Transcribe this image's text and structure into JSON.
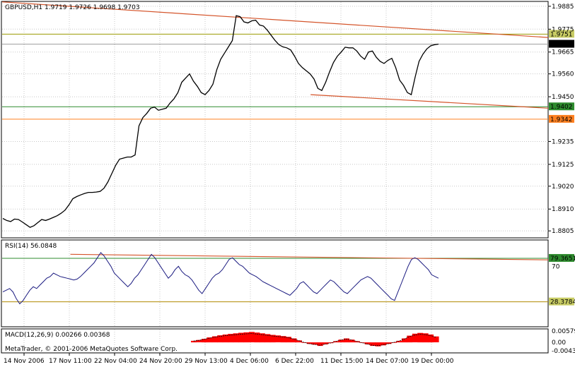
{
  "colors": {
    "background": "#ffffff",
    "frame": "#000000",
    "grid": "#c8c8c8",
    "price_line": "#000000",
    "trend_line": "#d4542a",
    "level_olive": "#9a9a00",
    "level_green": "#2e8b2e",
    "level_orange": "#ff8020",
    "rsi_line": "#1a1a80",
    "rsi_level_green": "#2e8b2e",
    "rsi_level_olive": "#b08a00",
    "macd_hist": "#ff0000",
    "macd_signal": "#000000",
    "tag_bg_light": "#c8cc64"
  },
  "chart_data": [
    {
      "type": "line",
      "panel": "price",
      "title": "GBPUSD,H1 1.9719 1.9726 1.9698 1.9703",
      "symbol": "GBPUSD,H1",
      "ohlc": [
        "1.9719",
        "1.9726",
        "1.9698",
        "1.9703"
      ],
      "ylim": [
        1.8775,
        1.9905
      ],
      "yticks": [
        "1.9885",
        "1.9775",
        "1.9665",
        "1.9560",
        "1.9450",
        "1.9235",
        "1.9125",
        "1.9020",
        "1.8910",
        "1.8805"
      ],
      "xlabels": [
        "14 Nov 2006",
        "17 Nov 11:00",
        "22 Nov 04:00",
        "24 Nov 20:00",
        "29 Nov 13:00",
        "4 Dec 06:00",
        "6 Dec 22:00",
        "11 Dec 15:00",
        "14 Dec 07:00",
        "19 Dec 00:00"
      ],
      "levels": [
        {
          "value": 1.9751,
          "label": "1.9751",
          "style": "olive"
        },
        {
          "value": 1.9402,
          "label": "1.9402",
          "style": "green"
        },
        {
          "value": 1.9342,
          "label": "1.9342",
          "style": "orange"
        }
      ],
      "current": {
        "value": 1.9703,
        "label": "1.9703"
      },
      "trendlines": [
        {
          "from": [
            0.0,
            1.9906
          ],
          "to": [
            1.0,
            1.9735
          ]
        },
        {
          "from": [
            0.565,
            1.946
          ],
          "to": [
            1.0,
            1.9395
          ]
        }
      ],
      "series": [
        {
          "values": [
            1.8865,
            1.8855,
            1.885,
            1.8862,
            1.886,
            1.8848,
            1.8835,
            1.8822,
            1.883,
            1.8845,
            1.886,
            1.8855,
            1.8862,
            1.887,
            1.8878,
            1.889,
            1.8905,
            1.893,
            1.896,
            1.897,
            1.8978,
            1.8985,
            1.899,
            1.899,
            1.8992,
            1.8995,
            1.901,
            1.904,
            1.908,
            1.912,
            1.915,
            1.9155,
            1.916,
            1.916,
            1.917,
            1.931,
            1.935,
            1.937,
            1.9395,
            1.94,
            1.9385,
            1.939,
            1.9395,
            1.942,
            1.944,
            1.947,
            1.952,
            1.954,
            1.956,
            1.9525,
            1.95,
            1.947,
            1.946,
            1.948,
            1.951,
            1.958,
            1.963,
            1.966,
            1.969,
            1.972,
            1.984,
            1.9835,
            1.981,
            1.9805,
            1.9815,
            1.9818,
            1.9795,
            1.979,
            1.977,
            1.9745,
            1.972,
            1.97,
            1.969,
            1.9685,
            1.9675,
            1.9645,
            1.961,
            1.959,
            1.9575,
            1.956,
            1.9535,
            1.949,
            1.948,
            1.952,
            1.957,
            1.9615,
            1.9645,
            1.9665,
            1.9688,
            1.9685,
            1.9685,
            1.967,
            1.9645,
            1.963,
            1.9665,
            1.967,
            1.964,
            1.962,
            1.961,
            1.9625,
            1.9635,
            1.959,
            1.953,
            1.9505,
            1.947,
            1.946,
            1.9545,
            1.962,
            1.9655,
            1.968,
            1.9695,
            1.97,
            1.9703
          ]
        }
      ]
    },
    {
      "type": "line",
      "panel": "indicator",
      "title": "RSI(14) 56.0848",
      "ylim": [
        0,
        100
      ],
      "levels": [
        {
          "value": 79.3651,
          "label": "79.3651",
          "style": "green"
        },
        {
          "value": 28.3784,
          "label": "28.3784",
          "style": "olive"
        }
      ],
      "yticks": [
        "70"
      ],
      "trendline": {
        "from": [
          0.125,
          84.0
        ],
        "to": [
          1.0,
          77.5
        ]
      },
      "series": [
        {
          "values": [
            40,
            42,
            44,
            40,
            32,
            26,
            30,
            36,
            42,
            46,
            44,
            48,
            52,
            56,
            58,
            62,
            60,
            58,
            57,
            56,
            55,
            54,
            55,
            58,
            62,
            66,
            70,
            74,
            80,
            86,
            82,
            76,
            70,
            62,
            58,
            54,
            50,
            46,
            50,
            56,
            60,
            66,
            72,
            78,
            84,
            80,
            74,
            68,
            62,
            56,
            60,
            66,
            70,
            64,
            60,
            58,
            54,
            48,
            42,
            38,
            44,
            50,
            56,
            60,
            62,
            66,
            72,
            78,
            80,
            76,
            72,
            70,
            66,
            62,
            60,
            58,
            55,
            52,
            50,
            48,
            46,
            44,
            42,
            40,
            38,
            36,
            40,
            44,
            50,
            52,
            48,
            44,
            40,
            38,
            42,
            46,
            50,
            54,
            52,
            48,
            44,
            40,
            38,
            42,
            46,
            50,
            54,
            56,
            58,
            56,
            52,
            48,
            44,
            40,
            36,
            32,
            30,
            40,
            50,
            60,
            70,
            78,
            80,
            78,
            74,
            70,
            66,
            60,
            58,
            56
          ]
        }
      ]
    },
    {
      "type": "bar",
      "panel": "indicator",
      "title": "MACD(12,26,9) 0.00266 0.00368",
      "ylim": [
        -0.005,
        0.0065
      ],
      "yticks": [
        "0.00579",
        "0.00",
        "-0.00431"
      ],
      "series": [
        {
          "name": "MACD",
          "values": [
            0.0008,
            0.0012,
            0.0018,
            0.0025,
            0.0031,
            0.0036,
            0.004,
            0.0043,
            0.0046,
            0.0049,
            0.0051,
            0.0053,
            0.005,
            0.0046,
            0.0042,
            0.0038,
            0.0035,
            0.0032,
            0.0028,
            0.002,
            0.001,
            0.0,
            -0.0008,
            -0.0012,
            -0.0018,
            -0.001,
            -0.0004,
            0.0006,
            0.0014,
            0.002,
            0.0014,
            0.0006,
            -0.0002,
            -0.001,
            -0.0018,
            -0.002,
            -0.0015,
            -0.0008,
            0.0,
            0.0008,
            0.002,
            0.0034,
            0.0044,
            0.0048,
            0.0046,
            0.004,
            0.003
          ]
        }
      ]
    }
  ],
  "footer_text": "MetaTrader, © 2001-2006 MetaQuotes Software Corp."
}
